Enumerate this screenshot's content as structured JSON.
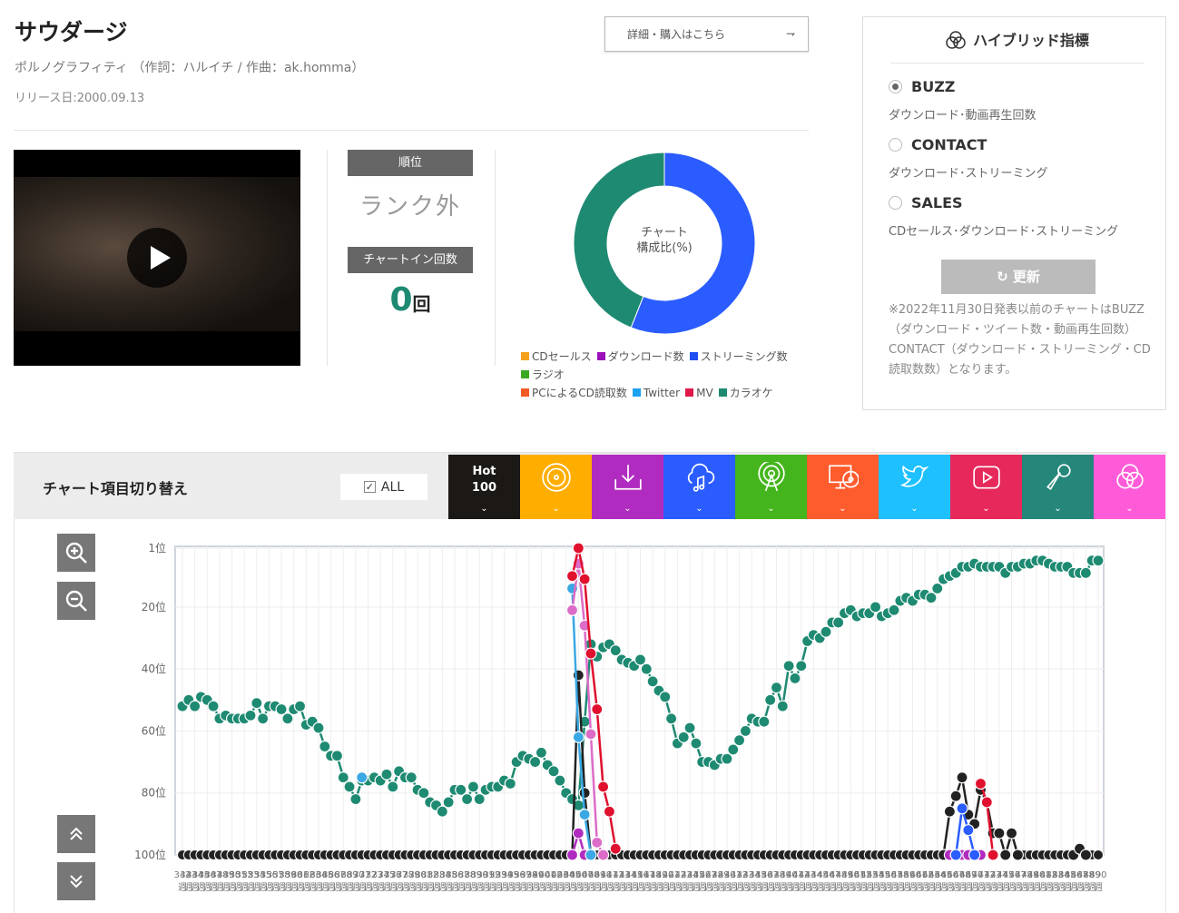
{
  "song": {
    "title": "サウダージ",
    "credit": "ポルノグラフィティ （作詞：ハルイチ / 作曲：ak.homma）",
    "release": "リリース日:2000.09.13",
    "buy_label": "詳細・購入はこちら",
    "buy_icon": "external-arrow-icon"
  },
  "stats": {
    "rank_label": "順位",
    "rank_value": "ランク外",
    "chartin_label": "チャートイン回数",
    "chartin_value": "0",
    "chartin_unit": "回"
  },
  "hybrid": {
    "title": "ハイブリッド指標",
    "options": [
      {
        "label": "BUZZ",
        "desc": "ダウンロード･動画再生回数",
        "selected": true
      },
      {
        "label": "CONTACT",
        "desc": "ダウンロード･ストリーミング",
        "selected": false
      },
      {
        "label": "SALES",
        "desc": "CDセールス･ダウンロード･ストリーミング",
        "selected": false
      }
    ],
    "update_label": "更新",
    "note": "※2022年11月30日発表以前のチャートはBUZZ（ダウンロード・ツイート数・動画再生回数）CONTACT（ダウンロード・ストリーミング・CD読取数数）となります。"
  },
  "switcher": {
    "title": "チャート項目切り替え",
    "all_label": "ALL",
    "all_checked": true,
    "hot_line1": "Hot",
    "hot_line2": "100",
    "categories": [
      {
        "name": "hot100",
        "color": "#1c1816",
        "icon": "hot100"
      },
      {
        "name": "cd-sales",
        "color": "#ffae00",
        "icon": "cd-icon"
      },
      {
        "name": "download",
        "color": "#b02cc0",
        "icon": "download-icon"
      },
      {
        "name": "streaming",
        "color": "#2a5cff",
        "icon": "cloud-music-icon"
      },
      {
        "name": "radio",
        "color": "#44b51c",
        "icon": "radio-icon"
      },
      {
        "name": "pc-cd-read",
        "color": "#ff5c2e",
        "icon": "pc-cd-icon"
      },
      {
        "name": "twitter",
        "color": "#1ec0ff",
        "icon": "twitter-icon"
      },
      {
        "name": "video",
        "color": "#e6285a",
        "icon": "play-video-icon"
      },
      {
        "name": "karaoke",
        "color": "#25877a",
        "icon": "microphone-icon"
      },
      {
        "name": "hybrid",
        "color": "#ff5bd8",
        "icon": "hybrid-circles-icon"
      }
    ]
  },
  "chart_data": [
    {
      "type": "pie",
      "title": "チャート構成比(%)",
      "title_line1": "チャート",
      "title_line2": "構成比(%)",
      "slices": [
        {
          "label": "ストリーミング数",
          "value": 56,
          "color": "#2a5cff"
        },
        {
          "label": "カラオケ",
          "value": 44,
          "color": "#1e8a72"
        }
      ],
      "legend": [
        {
          "label": "CDセールス",
          "color": "#f5a11c"
        },
        {
          "label": "ダウンロード数",
          "color": "#9b10b8"
        },
        {
          "label": "ストリーミング数",
          "color": "#1f4ff0"
        },
        {
          "label": "ラジオ",
          "color": "#3aa920"
        },
        {
          "label": "PCによるCD読取数",
          "color": "#f45a24"
        },
        {
          "label": "Twitter",
          "color": "#1ba1f2"
        },
        {
          "label": "MV",
          "color": "#e0194a"
        },
        {
          "label": "カラオケ",
          "color": "#1e8a72"
        }
      ]
    },
    {
      "type": "line",
      "ylabel_suffix": "位",
      "yticks": [
        1,
        20,
        40,
        60,
        80,
        100
      ],
      "ylim": [
        1,
        100
      ],
      "y_reversed": true,
      "x_start_week": 342,
      "x_end_week": 490,
      "x_label_suffix": "週",
      "series": [
        {
          "name": "Hot100",
          "color": "#222222",
          "baseline": 100,
          "points": [
            [
              406,
              42
            ],
            [
              407,
              80
            ],
            [
              466,
              86
            ],
            [
              467,
              81
            ],
            [
              468,
              75
            ],
            [
              469,
              87
            ],
            [
              470,
              90
            ],
            [
              471,
              79
            ],
            [
              472,
              83
            ],
            [
              473,
              93
            ],
            [
              474,
              93
            ],
            [
              476,
              93
            ],
            [
              487,
              98
            ]
          ]
        },
        {
          "name": "ダウンロード数",
          "color": "#b02cc0",
          "points": [
            [
              405,
              100
            ],
            [
              406,
              93
            ],
            [
              407,
              100
            ],
            [
              466,
              100
            ],
            [
              467,
              100
            ],
            [
              468,
              100
            ],
            [
              469,
              100
            ],
            [
              470,
              100
            ],
            [
              471,
              100
            ]
          ]
        },
        {
          "name": "ストリーミング数",
          "color": "#2a5cff",
          "points": [
            [
              467,
              100
            ],
            [
              468,
              85
            ],
            [
              469,
              92
            ],
            [
              470,
              100
            ]
          ]
        },
        {
          "name": "Twitter",
          "color": "#3aa8e4",
          "points": [
            [
              371,
              75
            ],
            [
              405,
              14
            ],
            [
              406,
              62
            ],
            [
              407,
              87
            ],
            [
              408,
              100
            ]
          ]
        },
        {
          "name": "hybrid",
          "color": "#dd6cc8",
          "points": [
            [
              405,
              21
            ],
            [
              406,
              6
            ],
            [
              407,
              26
            ],
            [
              408,
              61
            ],
            [
              409,
              96
            ],
            [
              410,
              100
            ]
          ]
        },
        {
          "name": "MV",
          "color": "#e0102e",
          "points": [
            [
              405,
              10
            ],
            [
              406,
              1
            ],
            [
              407,
              11
            ],
            [
              408,
              35
            ],
            [
              409,
              53
            ],
            [
              410,
              78
            ],
            [
              411,
              86
            ],
            [
              412,
              98
            ],
            [
              471,
              77
            ],
            [
              472,
              83
            ],
            [
              473,
              100
            ]
          ]
        },
        {
          "name": "カラオケ",
          "color": "#1e8a72",
          "values": [
            52,
            50,
            52,
            49,
            50,
            52,
            56,
            55,
            56,
            56,
            56,
            55,
            51,
            56,
            52,
            52,
            53,
            56,
            53,
            52,
            58,
            57,
            59,
            65,
            68,
            68,
            75,
            78,
            82,
            76,
            76,
            75,
            76,
            74,
            78,
            73,
            75,
            75,
            79,
            80,
            83,
            84,
            86,
            83,
            79,
            79,
            82,
            78,
            82,
            79,
            78,
            78,
            76,
            77,
            70,
            68,
            69,
            70,
            67,
            71,
            73,
            76,
            80,
            82,
            84,
            57,
            32,
            36,
            33,
            32,
            34,
            37,
            38,
            39,
            37,
            40,
            44,
            47,
            49,
            56,
            64,
            62,
            59,
            64,
            70,
            70,
            71,
            69,
            69,
            66,
            63,
            60,
            56,
            57,
            57,
            50,
            46,
            52,
            39,
            43,
            39,
            31,
            29,
            30,
            28,
            25,
            25,
            22,
            21,
            23,
            22,
            22,
            20,
            23,
            22,
            21,
            18,
            17,
            18,
            16,
            16,
            17,
            14,
            11,
            10,
            9,
            7,
            7,
            6,
            7,
            7,
            7,
            7,
            9,
            7,
            7,
            6,
            6,
            5,
            5,
            6,
            7,
            7,
            7,
            9,
            9,
            9,
            5,
            5
          ]
        }
      ]
    }
  ],
  "chart_controls": {
    "zoom_in": "zoom-in-icon",
    "zoom_out": "zoom-out-icon",
    "scroll_up": "double-chevron-up-icon",
    "scroll_down": "double-chevron-down-icon"
  }
}
